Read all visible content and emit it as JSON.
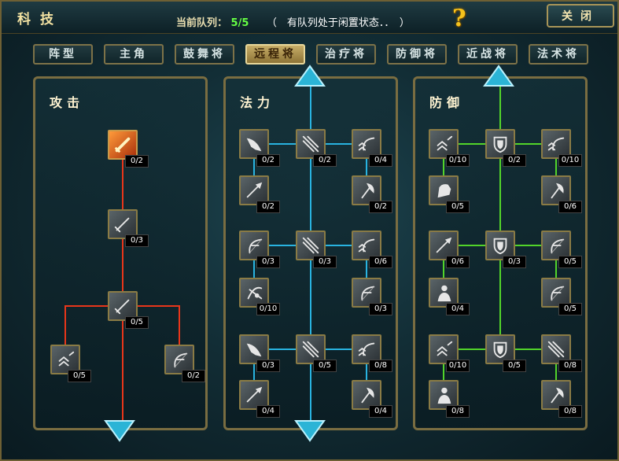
{
  "header": {
    "title": "科技",
    "queue_label": "当前队列：",
    "queue_count": "5/5",
    "queue_status": "（　有队列处于闲置状态．．　）",
    "help_icon": "?",
    "close_label": "关闭"
  },
  "tabs": [
    {
      "label": "阵型",
      "active": false
    },
    {
      "label": "主角",
      "active": false
    },
    {
      "label": "鼓舞将",
      "active": false
    },
    {
      "label": "远程将",
      "active": true
    },
    {
      "label": "治疗将",
      "active": false
    },
    {
      "label": "防御将",
      "active": false
    },
    {
      "label": "近战将",
      "active": false
    },
    {
      "label": "法术将",
      "active": false
    }
  ],
  "colors": {
    "attack_line": "#e8361a",
    "magic_line": "#29b3e0",
    "defense_line": "#52d42a",
    "gold_frame": "#8a7b45"
  },
  "panels": [
    {
      "title": "攻击",
      "line_color": "#e8361a",
      "nodes": [
        {
          "level": "0/2",
          "icon": "flaming-sword-icon",
          "highlight": true
        },
        {
          "level": "0/3",
          "icon": "sword-icon"
        },
        {
          "level": "0/5",
          "icon": "sword-icon"
        },
        {
          "level": "0/5",
          "icon": "chevron-rank-icon"
        },
        {
          "level": "0/2",
          "icon": "bow-icon"
        }
      ]
    },
    {
      "title": "法力",
      "line_color": "#29b3e0",
      "nodes": [
        {
          "level": "0/2",
          "icon": "wing-icon"
        },
        {
          "level": "0/2",
          "icon": "claw-icon"
        },
        {
          "level": "0/4",
          "icon": "bow-rank-icon"
        },
        {
          "level": "0/2",
          "icon": "spear-icon"
        },
        {
          "level": "0/2",
          "icon": "axe-icon"
        },
        {
          "level": "0/3",
          "icon": "bow-icon"
        },
        {
          "level": "0/3",
          "icon": "claw-icon"
        },
        {
          "level": "0/6",
          "icon": "bow-rank-icon"
        },
        {
          "level": "0/10",
          "icon": "archer-icon"
        },
        {
          "level": "0/3",
          "icon": "bow-icon"
        },
        {
          "level": "0/3",
          "icon": "wing-icon"
        },
        {
          "level": "0/5",
          "icon": "claw-icon"
        },
        {
          "level": "0/8",
          "icon": "bow-rank-icon"
        },
        {
          "level": "0/4",
          "icon": "spear-icon"
        },
        {
          "level": "0/4",
          "icon": "axe-icon"
        }
      ]
    },
    {
      "title": "防御",
      "line_color": "#52d42a",
      "nodes": [
        {
          "level": "0/10",
          "icon": "chevron-rank-icon"
        },
        {
          "level": "0/2",
          "icon": "shield-icon"
        },
        {
          "level": "0/10",
          "icon": "bow-rank-icon"
        },
        {
          "level": "0/5",
          "icon": "fist-icon"
        },
        {
          "level": "0/6",
          "icon": "axe-icon"
        },
        {
          "level": "0/6",
          "icon": "spear-icon"
        },
        {
          "level": "0/3",
          "icon": "shield-icon"
        },
        {
          "level": "0/5",
          "icon": "bow-icon"
        },
        {
          "level": "0/4",
          "icon": "soldier-icon"
        },
        {
          "level": "0/5",
          "icon": "bow-icon"
        },
        {
          "level": "0/10",
          "icon": "chevron-rank-icon"
        },
        {
          "level": "0/5",
          "icon": "shield-icon"
        },
        {
          "level": "0/8",
          "icon": "claw-icon"
        },
        {
          "level": "0/8",
          "icon": "soldier-icon"
        },
        {
          "level": "0/8",
          "icon": "axe-icon"
        }
      ]
    }
  ]
}
